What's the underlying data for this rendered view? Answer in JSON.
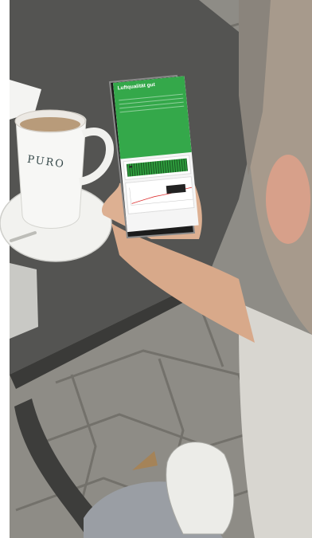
{
  "cup": {
    "brand": "PURO"
  },
  "phone_app": {
    "title": "Luftqualität gut",
    "subtitle": "",
    "metrics": [
      {
        "label": "",
        "value": ""
      },
      {
        "label": "",
        "value": ""
      },
      {
        "label": "",
        "value": ""
      },
      {
        "label": "",
        "value": ""
      }
    ],
    "panel_top_label": "",
    "panel_bottom_label": ""
  },
  "colors": {
    "app_green": "#34a84a",
    "cobblestone": "#8d8d87",
    "table_top": "#555553"
  }
}
